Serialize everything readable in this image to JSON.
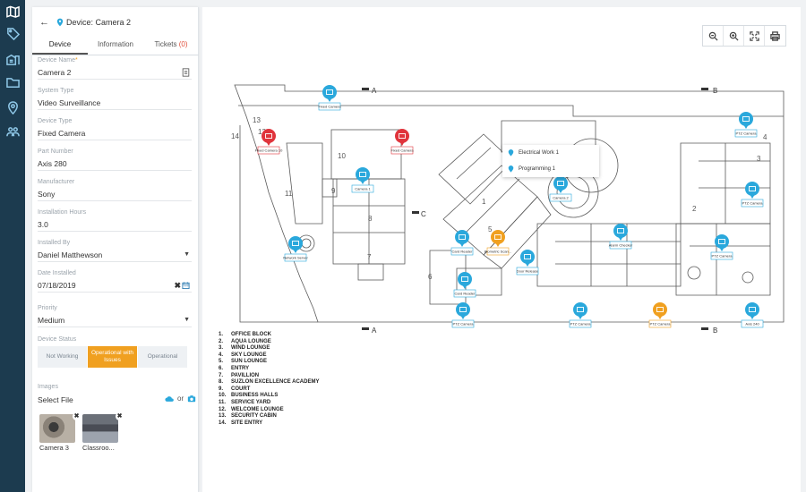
{
  "rail": {
    "icons": [
      "map-icon",
      "tag-icon",
      "buildings-icon",
      "folder-icon",
      "location-pin-icon",
      "users-icon"
    ]
  },
  "panel": {
    "title": "Device: Camera 2",
    "tabs": [
      {
        "label": "Device"
      },
      {
        "label": "Information"
      },
      {
        "label": "Tickets",
        "count": "(0)"
      }
    ],
    "fields": {
      "device_name": {
        "label": "Device Name",
        "value": "Camera 2"
      },
      "system_type": {
        "label": "System Type",
        "value": "Video Surveillance"
      },
      "device_type": {
        "label": "Device Type",
        "value": "Fixed Camera"
      },
      "part_number": {
        "label": "Part Number",
        "value": "Axis 280"
      },
      "manufacturer": {
        "label": "Manufacturer",
        "value": "Sony"
      },
      "installation_hours": {
        "label": "Installation Hours",
        "value": "3.0"
      },
      "installed_by": {
        "label": "Installed By",
        "value": "Daniel Matthewson"
      },
      "date_installed": {
        "label": "Date Installed",
        "value": "07/18/2019"
      },
      "priority": {
        "label": "Priority",
        "value": "Medium"
      }
    },
    "device_status": {
      "label": "Device Status",
      "options": [
        "Not Working",
        "Operational with Issues",
        "Operational"
      ],
      "selected": "Operational with Issues"
    },
    "images": {
      "label": "Images",
      "select_file": "Select File",
      "or": "or",
      "thumbs": [
        "Camera 3",
        "Classroo..."
      ]
    }
  },
  "map": {
    "section_marks": [
      "A",
      "B",
      "A",
      "B",
      "C"
    ],
    "room_numbers": [
      "1",
      "2",
      "3",
      "4",
      "5",
      "6",
      "7",
      "8",
      "9",
      "10",
      "11",
      "12",
      "13",
      "14"
    ],
    "popup": {
      "items": [
        "Electrical Work 1",
        "Programming 1"
      ]
    },
    "legend": [
      {
        "n": "1.",
        "text": "OFFICE BLOCK"
      },
      {
        "n": "2.",
        "text": "AQUA LOUNGE"
      },
      {
        "n": "3.",
        "text": "WIND LOUNGE"
      },
      {
        "n": "4.",
        "text": "SKY LOUNGE"
      },
      {
        "n": "5.",
        "text": "SUN LOUNGE"
      },
      {
        "n": "6.",
        "text": "ENTRY"
      },
      {
        "n": "7.",
        "text": "PAVILLION"
      },
      {
        "n": "8.",
        "text": "SUZLON EXCELLENCE ACADEMY"
      },
      {
        "n": "9.",
        "text": "COURT"
      },
      {
        "n": "10.",
        "text": "BUSINESS HALLS"
      },
      {
        "n": "11.",
        "text": "SERVICE YARD"
      },
      {
        "n": "12.",
        "text": "WELCOME LOUNGE"
      },
      {
        "n": "13.",
        "text": "SECURITY CABIN"
      },
      {
        "n": "14.",
        "text": "SITE ENTRY"
      }
    ],
    "markers": [
      {
        "label": "Fixed Camera",
        "color": "blue"
      },
      {
        "label": "Fixed Camera 10",
        "color": "red"
      },
      {
        "label": "Fixed Camera",
        "color": "red"
      },
      {
        "label": "Camera 1",
        "color": "blue"
      },
      {
        "label": "Network Server",
        "color": "blue"
      },
      {
        "label": "Card Reader",
        "color": "blue"
      },
      {
        "label": "Card Reader",
        "color": "blue"
      },
      {
        "label": "Biometric Scan...",
        "color": "orange"
      },
      {
        "label": "Door Release",
        "color": "blue"
      },
      {
        "label": "Camera 2",
        "color": "blue"
      },
      {
        "label": "Alarm Checker",
        "color": "blue"
      },
      {
        "label": "PTZ Camera",
        "color": "blue"
      },
      {
        "label": "PTZ Camera",
        "color": "blue"
      },
      {
        "label": "PTZ Camera",
        "color": "blue"
      },
      {
        "label": "PTZ Camera",
        "color": "blue"
      },
      {
        "label": "PTZ Camera",
        "color": "orange"
      },
      {
        "label": "PTZ Camera",
        "color": "blue"
      },
      {
        "label": "Axis 240",
        "color": "blue"
      }
    ]
  },
  "colors": {
    "accent": "#f0a020",
    "blue": "#2aa8dc",
    "red": "#e0343c",
    "rail": "#1c3b4f"
  }
}
